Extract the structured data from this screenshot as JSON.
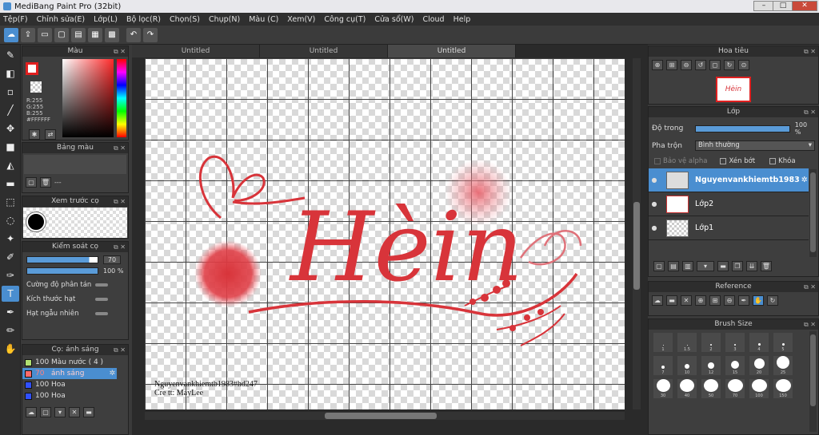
{
  "window": {
    "title": "MediBang Paint Pro (32bit)"
  },
  "menu": [
    "Tệp(F)",
    "Chỉnh sửa(E)",
    "Lớp(L)",
    "Bộ lọc(R)",
    "Chọn(S)",
    "Chụp(N)",
    "Màu (C)",
    "Xem(V)",
    "Công cụ(T)",
    "Cửa sổ(W)",
    "Cloud",
    "Help"
  ],
  "tabs": [
    "Untitled",
    "Untitled",
    "Untitled"
  ],
  "color_panel": {
    "title": "Màu",
    "r": "R:255",
    "g": "G:255",
    "b": "B:255",
    "hex": "#FFFFFF"
  },
  "palette_panel": {
    "title": "Bảng màu",
    "value": "---"
  },
  "preview_panel": {
    "title": "Xem trước cọ"
  },
  "brush_control": {
    "title": "Kiểm soát cọ",
    "size": "70",
    "opacity": "100 %",
    "opt1": "Cường độ phân tán",
    "opt2": "Kích thước hạt",
    "opt3": "Hạt ngẫu nhiên"
  },
  "brush_list": {
    "title": "Cọ: ánh sáng",
    "items": [
      {
        "size": "100",
        "name": "Màu nước ( 4 )",
        "color": "#b0e070"
      },
      {
        "size": "70",
        "name": "ánh sáng",
        "color": "#ff6a6a"
      },
      {
        "size": "100",
        "name": "Hoa",
        "color": "#3050ff"
      },
      {
        "size": "100",
        "name": "Hoa",
        "color": "#3050ff"
      }
    ]
  },
  "canvas": {
    "artwork_text": "Hèin",
    "signature_line1": "Nguyenvankhiemtb1983#hd247",
    "signature_line2": "Cre tt: MayLee"
  },
  "navigator_panel": {
    "title": "Hoa tiêu"
  },
  "layer_panel": {
    "title": "Lớp",
    "opacity_label": "Độ trong",
    "opacity_value": "100 %",
    "blend_label": "Pha trộn",
    "blend_value": "Bình thường",
    "protect_alpha": "Bảo vệ alpha",
    "clipping": "Xén bớt",
    "lock": "Khóa",
    "layers": [
      {
        "name": "Nguyenvankhiemtb1983",
        "selected": true
      },
      {
        "name": "Lớp2",
        "selected": false
      },
      {
        "name": "Lớp1",
        "selected": false
      }
    ]
  },
  "reference_panel": {
    "title": "Reference"
  },
  "brush_size_panel": {
    "title": "Brush Size",
    "sizes": [
      "1",
      "1.5",
      "2",
      "3",
      "4",
      "5",
      "7",
      "10",
      "12",
      "15",
      "20",
      "25",
      "30",
      "40",
      "50",
      "70",
      "100",
      "150"
    ]
  },
  "colors": {
    "accent": "#4a8ed0",
    "art_red": "#d8343a"
  }
}
